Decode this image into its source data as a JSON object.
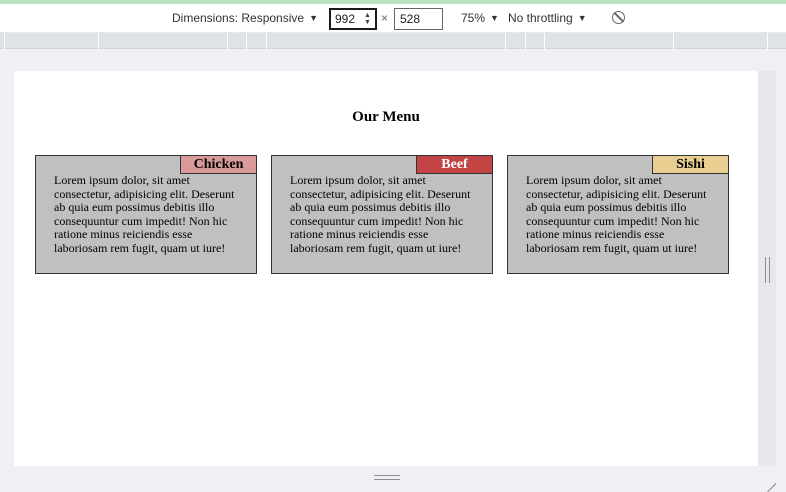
{
  "toolbar": {
    "dimensions_label": "Dimensions: Responsive",
    "width_value": "992",
    "times_sign": "×",
    "height_value": "528",
    "zoom_label": "75%",
    "throttling_label": "No throttling",
    "rotate_icon": "no-entry-icon"
  },
  "page": {
    "title": "Our Menu",
    "cards": [
      {
        "badge": "Chicken",
        "badge_color": "#d99a9a",
        "badge_text_color": "#000000",
        "text": "Lorem ipsum dolor, sit amet consectetur, adipisicing elit. Deserunt ab quia eum possimus debitis illo consequuntur cum impedit! Non hic ratione minus reiciendis esse laboriosam rem fugit, quam ut iure!"
      },
      {
        "badge": "Beef",
        "badge_color": "#c24444",
        "badge_text_color": "#ffffff",
        "text": "Lorem ipsum dolor, sit amet consectetur, adipisicing elit. Deserunt ab quia eum possimus debitis illo consequuntur cum impedit! Non hic ratione minus reiciendis esse laboriosam rem fugit, quam ut iure!"
      },
      {
        "badge": "Sishi",
        "badge_color": "#e8cf91",
        "badge_text_color": "#000000",
        "text": "Lorem ipsum dolor, sit amet consectetur, adipisicing elit. Deserunt ab quia eum possimus debitis illo consequuntur cum impedit! Non hic ratione minus reiciendis esse laboriosam rem fugit, quam ut iure!"
      }
    ]
  }
}
